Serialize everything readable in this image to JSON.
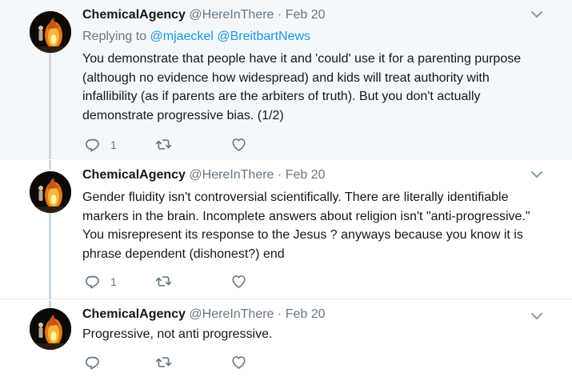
{
  "tweets": [
    {
      "name": "ChemicalAgency",
      "handle": "@HereInThere",
      "separator": "·",
      "date": "Feb 20",
      "replying_prefix": "Replying to",
      "mentions": [
        "@mjaeckel",
        "@BreitbartNews"
      ],
      "text": "You demonstrate that people have it and 'could' use it for a parenting purpose (although no evidence how widespread) and kids will treat authority with infallibility (as if parents are the arbiters of truth). But you don't actually demonstrate progressive bias. (1/2)",
      "reply_count": "1"
    },
    {
      "name": "ChemicalAgency",
      "handle": "@HereInThere",
      "separator": "·",
      "date": "Feb 20",
      "text": "Gender fluidity isn't controversial scientifically. There are literally identifiable markers in the brain. Incomplete answers about religion isn't \"anti-progressive.\" You misrepresent its response to the Jesus ? anyways because you know it is phrase dependent (dishonest?) end",
      "reply_count": "1"
    },
    {
      "name": "ChemicalAgency",
      "handle": "@HereInThere",
      "separator": "·",
      "date": "Feb 20",
      "text": "Progressive, not anti progressive."
    }
  ],
  "icons": {
    "reply": "reply-icon",
    "retweet": "retweet-icon",
    "like": "heart-icon",
    "more": "chevron-down-icon"
  },
  "colors": {
    "highlight_bg": "#f5f8fa",
    "link": "#1b95e0",
    "secondary_text": "#657786",
    "thread_line": "#cdd7df"
  }
}
